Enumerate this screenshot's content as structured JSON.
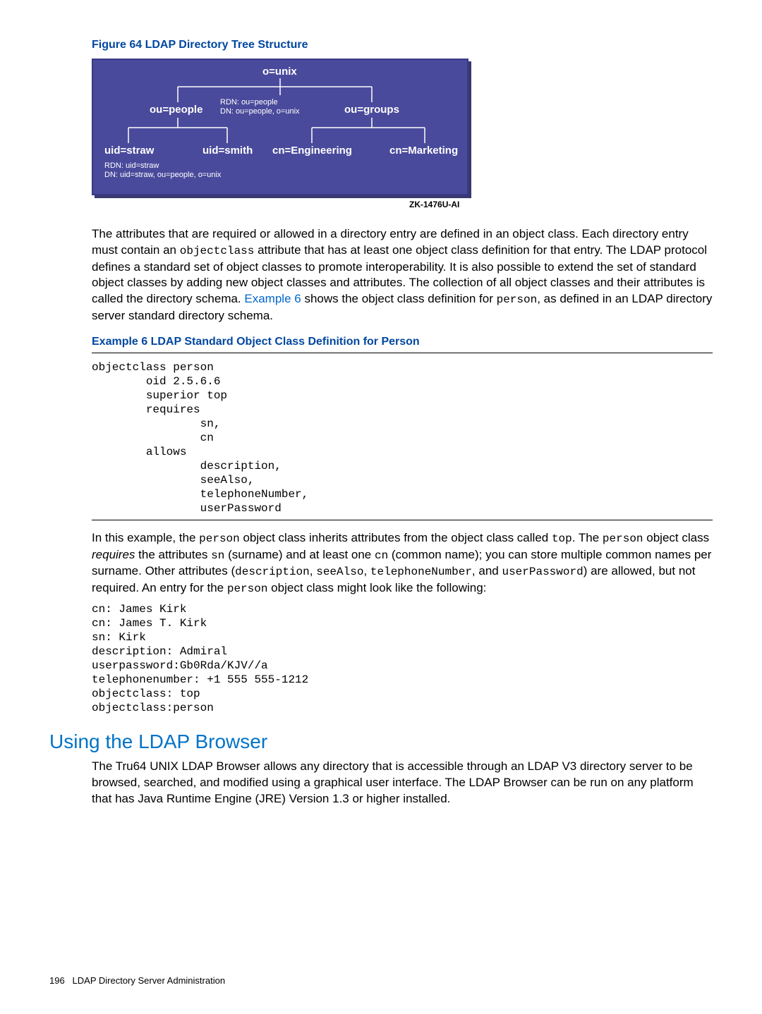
{
  "figure": {
    "caption": "Figure 64 LDAP Directory Tree Structure",
    "root": "o=unix",
    "level2": {
      "people": "ou=people",
      "rdn_line1": "RDN:  ou=people",
      "rdn_line2": "DN:  ou=people, o=unix",
      "groups": "ou=groups"
    },
    "level3": {
      "straw": "uid=straw",
      "smith": "uid=smith",
      "eng": "cn=Engineering",
      "mktg": "cn=Marketing"
    },
    "straw_rdn": "RDN:  uid=straw",
    "straw_dn": "DN:  uid=straw, ou=people, o=unix",
    "zk": "ZK-1476U-AI"
  },
  "para1_a": "The attributes that are required or allowed in a directory entry are defined in an object class. Each directory entry must contain an ",
  "para1_code1": "objectclass",
  "para1_b": " attribute that has at least one object class definition for that entry. The LDAP protocol defines a standard set of object classes to promote interoperability. It is also possible to extend the set of standard object classes by adding new object classes and attributes. The collection of all object classes and their attributes is called the directory schema. ",
  "para1_link": "Example 6",
  "para1_c": " shows the object class definition for ",
  "para1_code2": "person",
  "para1_d": ", as defined in an LDAP directory server standard directory schema.",
  "example": {
    "title": "Example 6 LDAP Standard Object Class Definition for Person",
    "code": "objectclass person\n        oid 2.5.6.6\n        superior top\n        requires\n                sn,\n                cn\n        allows\n                description,\n                seeAlso,\n                telephoneNumber,\n                userPassword"
  },
  "para2": {
    "t1": "In this example, the ",
    "c1": "person",
    "t2": " object class inherits attributes from the object class called ",
    "c2": "top",
    "t3": ". The ",
    "c3": "person",
    "t4": " object class ",
    "i1": "requires",
    "t5": " the attributes ",
    "c4": "sn",
    "t6": " (surname) and at least one ",
    "c5": "cn",
    "t7": " (common name); you can store multiple common names per surname. Other attributes (",
    "c6": "description",
    "t8": ", ",
    "c7": "seeAlso",
    "t9": ", ",
    "c8": "telephoneNumber",
    "t10": ", and ",
    "c9": "userPassword",
    "t11": ") are allowed, but not required. An entry for the ",
    "c10": "person",
    "t12": " object class might look like the following:"
  },
  "entry_code": "cn: James Kirk\ncn: James T. Kirk\nsn: Kirk\ndescription: Admiral\nuserpassword:Gb0Rda/KJV//a\ntelephonenumber: +1 555 555-1212\nobjectclass: top\nobjectclass:person",
  "section_heading": "Using the LDAP Browser",
  "para3": "The Tru64 UNIX LDAP Browser allows any directory that is accessible through an LDAP V3 directory server to be browsed, searched, and modified using a graphical user interface. The LDAP Browser can be run on any platform that has Java Runtime Engine (JRE) Version 1.3 or higher installed.",
  "footer": {
    "page": "196",
    "title": "LDAP Directory Server Administration"
  }
}
